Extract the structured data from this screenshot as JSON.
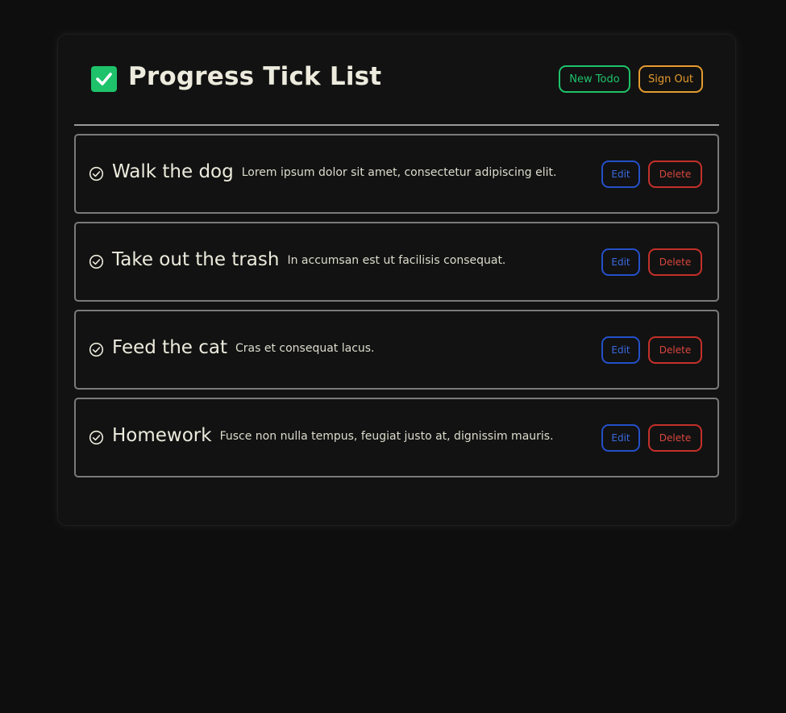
{
  "header": {
    "title": "Progress Tick List",
    "logo_icon": "checkbox-checked-icon",
    "new_todo_label": "New Todo",
    "sign_out_label": "Sign Out"
  },
  "colors": {
    "background": "#0e0e0e",
    "card": "#121212",
    "accent_green": "#1ec26a",
    "accent_orange": "#e59b2e",
    "edit_blue": "#2450c8",
    "delete_red": "#c4302a"
  },
  "todos": [
    {
      "title": "Walk the dog",
      "description": "Lorem ipsum dolor sit amet, consectetur adipiscing elit.",
      "edit_label": "Edit",
      "delete_label": "Delete"
    },
    {
      "title": "Take out the trash",
      "description": "In accumsan est ut facilisis consequat.",
      "edit_label": "Edit",
      "delete_label": "Delete"
    },
    {
      "title": "Feed the cat",
      "description": "Cras et consequat lacus.",
      "edit_label": "Edit",
      "delete_label": "Delete"
    },
    {
      "title": "Homework",
      "description": "Fusce non nulla tempus, feugiat justo at, dignissim mauris.",
      "edit_label": "Edit",
      "delete_label": "Delete"
    }
  ]
}
